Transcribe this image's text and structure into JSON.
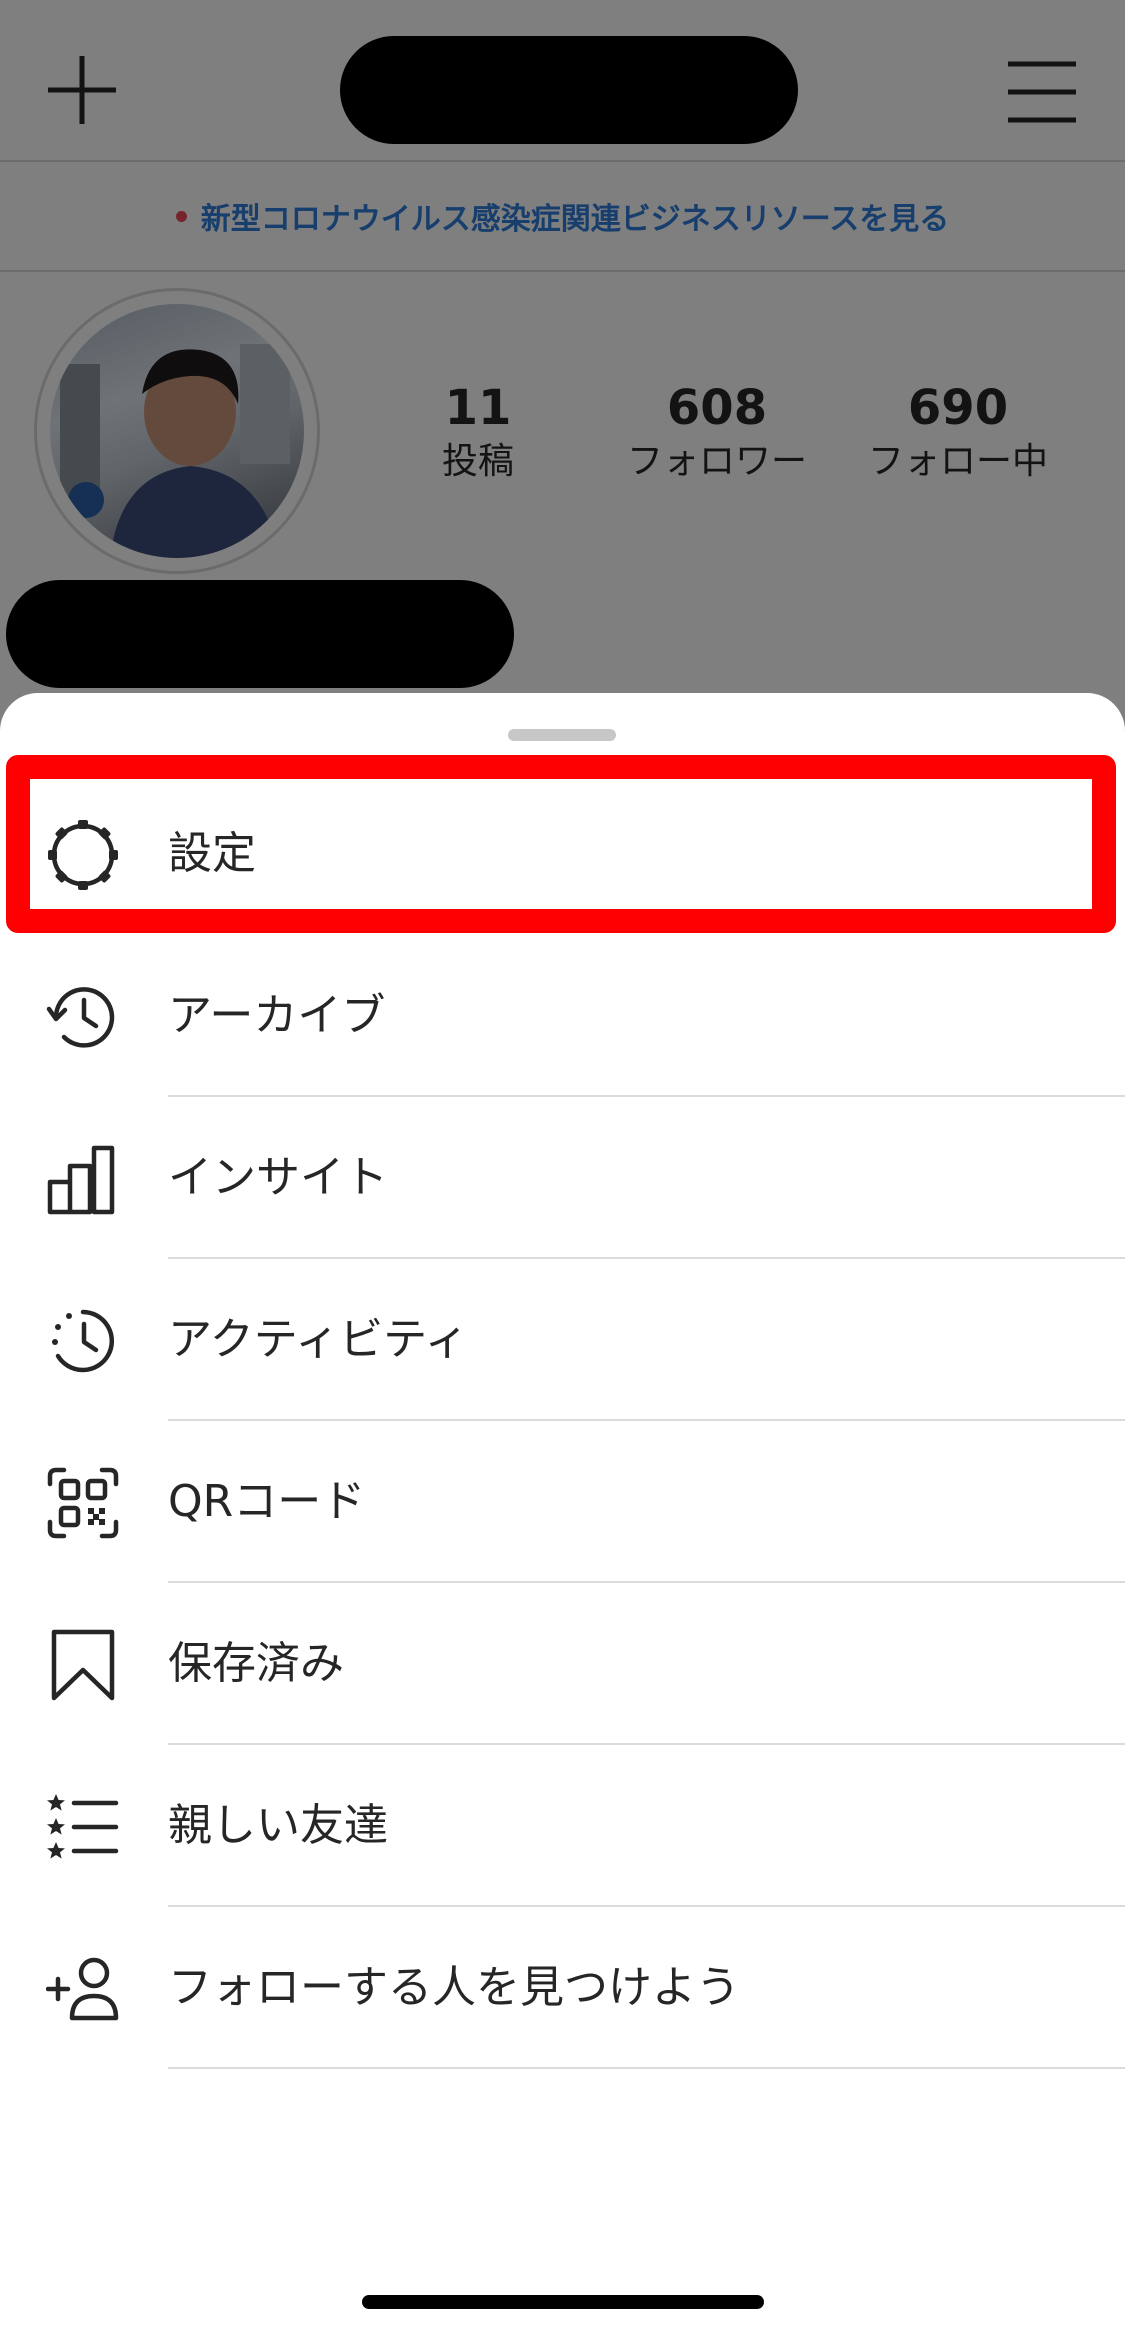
{
  "profile": {
    "banner_text": "新型コロナウイルス感染症関連ビジネスリソースを見る",
    "stats": {
      "posts_count": "11",
      "posts_label": "投稿",
      "followers_count": "608",
      "followers_label": "フォロワー",
      "following_count": "690",
      "following_label": "フォロー中"
    },
    "accent_color": "#2f7dd8"
  },
  "menu": {
    "items": [
      {
        "label": "設定",
        "icon": "gear-icon",
        "highlighted": true
      },
      {
        "label": "アーカイブ",
        "icon": "archive-history-icon"
      },
      {
        "label": "インサイト",
        "icon": "insights-bar-chart-icon"
      },
      {
        "label": "アクティビティ",
        "icon": "activity-clock-icon"
      },
      {
        "label": "QRコード",
        "icon": "qr-code-icon"
      },
      {
        "label": "保存済み",
        "icon": "bookmark-icon"
      },
      {
        "label": "親しい友達",
        "icon": "close-friends-list-icon"
      },
      {
        "label": "フォローする人を見つけよう",
        "icon": "add-person-icon"
      }
    ],
    "highlight_color": "#ff0000"
  }
}
